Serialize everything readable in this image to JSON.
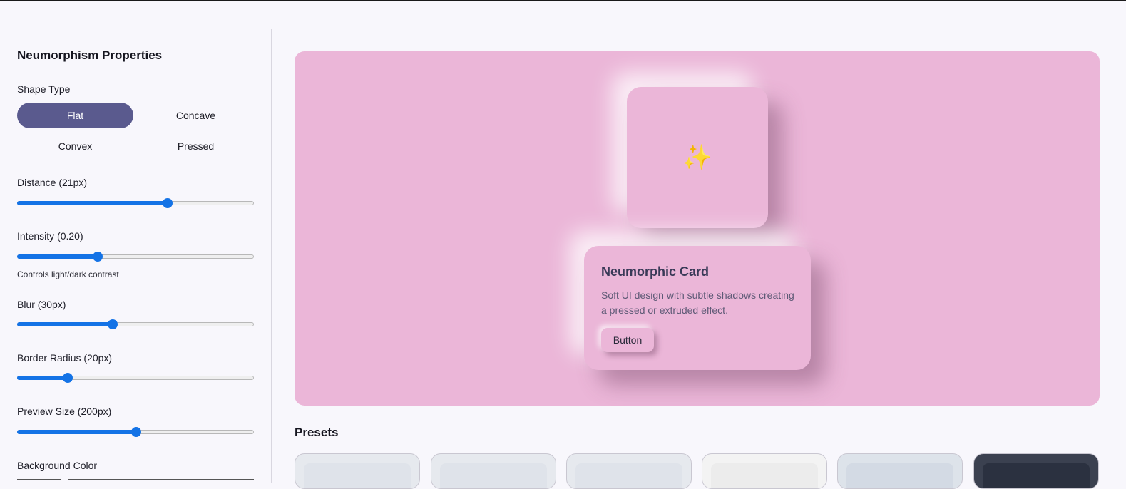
{
  "sidebar": {
    "title": "Neumorphism Properties",
    "shape_type": {
      "label": "Shape Type",
      "options": [
        "Flat",
        "Concave",
        "Convex",
        "Pressed"
      ],
      "selected": "Flat"
    },
    "distance": {
      "label": "Distance (21px)",
      "value_fraction": 0.635
    },
    "intensity": {
      "label": "Intensity (0.20)",
      "value_fraction": 0.34,
      "hint": "Controls light/dark contrast"
    },
    "blur": {
      "label": "Blur (30px)",
      "value_fraction": 0.405
    },
    "border_radius": {
      "label": "Border Radius (20px)",
      "value_fraction": 0.215
    },
    "preview_size": {
      "label": "Preview Size (200px)",
      "value_fraction": 0.502
    },
    "background_color": {
      "label": "Background Color"
    }
  },
  "preview": {
    "background_color": "#ebb6d8",
    "icon": "sparkles-icon",
    "icon_glyph": "✨",
    "card": {
      "title": "Neumorphic Card",
      "description": "Soft UI design with subtle shadows creating a pressed or extruded effect.",
      "button_label": "Button"
    }
  },
  "presets": {
    "title": "Presets",
    "items": [
      {
        "outer": "#e6e9ee",
        "inner": "#dfe3ea"
      },
      {
        "outer": "#e6e9ee",
        "inner": "#dfe3ea"
      },
      {
        "outer": "#e6e9ee",
        "inner": "#dfe3ea"
      },
      {
        "outer": "#f3f3f3",
        "inner": "#ececec"
      },
      {
        "outer": "#dde3ea",
        "inner": "#d3dae4"
      },
      {
        "outer": "#3b4150",
        "inner": "#2b3140"
      }
    ]
  },
  "colors": {
    "accent": "#5a5a8e",
    "slider": "#1473e6",
    "preview_bg": "#ebb6d8"
  }
}
